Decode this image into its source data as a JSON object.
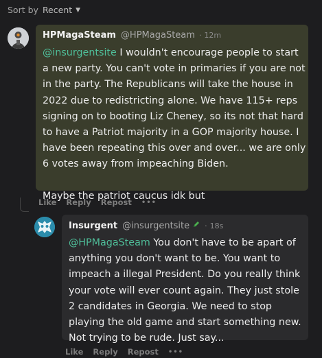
{
  "sort": {
    "label": "Sort by",
    "value": "Recent"
  },
  "comments": [
    {
      "author": "HPMagaSteam",
      "handle": "@HPMagaSteam",
      "time": "12m",
      "mention": "@insurgentsite",
      "text": " I wouldn't encourage people to start a new party. You can't vote in primaries if you are not in the party. The Republicans will take the house in 2022 due to redistricting alone. We have 115+ reps signing on to booting Liz Cheney, so its not that hard to have a Patriot majority in a GOP majority house. I have been repeating this over and over... we are only 6 votes away from impeaching Biden.",
      "text2": "Maybe the patriot caucus idk but",
      "actions": {
        "like": "Like",
        "reply": "Reply",
        "repost": "Repost",
        "more": "•••"
      }
    },
    {
      "author": "Insurgent",
      "handle": "@insurgentsite",
      "time": "18s",
      "mention": "@HPMagaSteam",
      "text": " You don't have to be apart of anything you don't want to be. You want to impeach a illegal President. Do you really think your vote will ever count again. They just stole 2 candidates in Georgia. We need to stop playing the old game and start something new. Not trying to be rude. Just say...",
      "actions": {
        "like": "Like",
        "reply": "Reply",
        "repost": "Repost",
        "more": "•••"
      }
    }
  ],
  "colors": {
    "mention": "#4fbf9a",
    "card_highlight": "#3a3d2c",
    "card": "#2b2b2d",
    "background": "#1d1d1f",
    "verified_pen": "#4caf50"
  }
}
